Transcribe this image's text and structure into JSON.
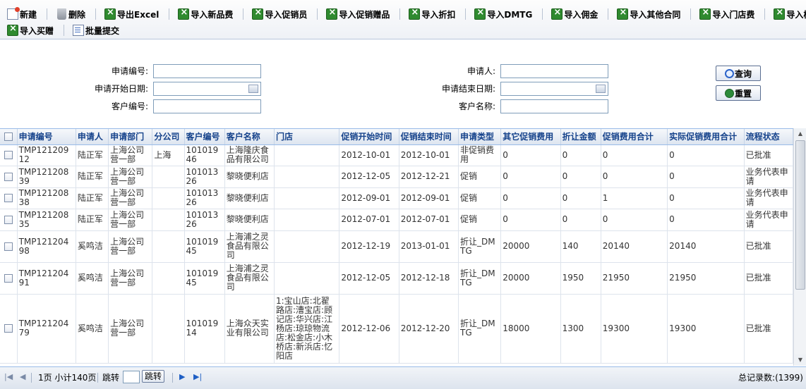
{
  "toolbar": {
    "row1": [
      {
        "label": "新建",
        "icon": "new-icon",
        "name": "new-button"
      },
      {
        "label": "删除",
        "icon": "trash-icon",
        "name": "delete-button"
      },
      {
        "label": "导出Excel",
        "icon": "excel-icon",
        "name": "export-excel-button"
      },
      {
        "label": "导入新品费",
        "icon": "excel-icon",
        "name": "import-new-product-fee-button"
      },
      {
        "label": "导入促销员",
        "icon": "excel-icon",
        "name": "import-promoter-button"
      },
      {
        "label": "导入促销赠品",
        "icon": "excel-icon",
        "name": "import-promo-gift-button"
      },
      {
        "label": "导入折扣",
        "icon": "excel-icon",
        "name": "import-discount-button"
      },
      {
        "label": "导入DMTG",
        "icon": "excel-icon",
        "name": "import-dmtg-button"
      },
      {
        "label": "导入佣金",
        "icon": "excel-icon",
        "name": "import-commission-button"
      },
      {
        "label": "导入其他合同",
        "icon": "excel-icon",
        "name": "import-other-contract-button"
      },
      {
        "label": "导入门店费",
        "icon": "excel-icon",
        "name": "import-store-fee-button"
      },
      {
        "label": "导入样赠",
        "icon": "excel-icon",
        "name": "import-sample-gift-button"
      }
    ],
    "row2": [
      {
        "label": "导入买赠",
        "icon": "excel-icon",
        "name": "import-buy-gift-button"
      },
      {
        "label": "批量提交",
        "icon": "submit-icon",
        "name": "batch-submit-button"
      }
    ]
  },
  "search": {
    "app_no_label": "申请编号:",
    "applicant_label": "申请人:",
    "start_date_label": "申请开始日期:",
    "end_date_label": "申请结束日期:",
    "customer_no_label": "客户编号:",
    "customer_name_label": "客户名称:",
    "query_button": "查询",
    "reset_button": "重置"
  },
  "grid": {
    "columns": [
      "申请编号",
      "申请人",
      "申请部门",
      "分公司",
      "客户编号",
      "客户名称",
      "门店",
      "促销开始时间",
      "促销结束时间",
      "申请类型",
      "其它促销费用",
      "折让金额",
      "促销费用合计",
      "实际促销费用合计",
      "流程状态"
    ],
    "rows": [
      [
        "TMP12120912",
        "陆正军",
        "上海公司营一部",
        "上海",
        "10101946",
        "上海隆庆食品有限公司",
        "",
        "2012-10-01",
        "2012-10-01",
        "非促销费用",
        "0",
        "0",
        "0",
        "0",
        "已批准"
      ],
      [
        "TMP12120839",
        "陆正军",
        "上海公司营一部",
        "",
        "10101326",
        "黎晓便利店",
        "",
        "2012-12-05",
        "2012-12-21",
        "促销",
        "0",
        "0",
        "0",
        "0",
        "业务代表申请"
      ],
      [
        "TMP12120838",
        "陆正军",
        "上海公司营一部",
        "",
        "10101326",
        "黎晓便利店",
        "",
        "2012-09-01",
        "2012-09-01",
        "促销",
        "0",
        "0",
        "1",
        "0",
        "业务代表申请"
      ],
      [
        "TMP12120835",
        "陆正军",
        "上海公司营一部",
        "",
        "10101326",
        "黎晓便利店",
        "",
        "2012-07-01",
        "2012-07-01",
        "促销",
        "0",
        "0",
        "0",
        "0",
        "业务代表申请"
      ],
      [
        "TMP12120498",
        "奚鸣洁",
        "上海公司营一部",
        "",
        "10101945",
        "上海浦之灵食品有限公司",
        "",
        "2012-12-19",
        "2013-01-01",
        "折让_DMTG",
        "20000",
        "140",
        "20140",
        "20140",
        "已批准"
      ],
      [
        "TMP12120491",
        "奚鸣洁",
        "上海公司营一部",
        "",
        "10101945",
        "上海浦之灵食品有限公司",
        "",
        "2012-12-05",
        "2012-12-18",
        "折让_DMTG",
        "20000",
        "1950",
        "21950",
        "21950",
        "已批准"
      ],
      [
        "TMP12120479",
        "奚鸣洁",
        "上海公司营一部",
        "",
        "10101914",
        "上海众天实业有限公司",
        "1:宝山店:北翟路店:漕宝店:顾记店:华兴店:江杨店:琼琼物流店:松金店:小木桥店:新浜店:忆阳店",
        "2012-12-06",
        "2012-12-20",
        "折让_DMTG",
        "18000",
        "1300",
        "19300",
        "19300",
        "已批准"
      ]
    ]
  },
  "pager": {
    "page_info": "1页 小计140页",
    "jump_label": "跳转",
    "jump_button": "跳转",
    "total": "总记录数:(1399)"
  }
}
